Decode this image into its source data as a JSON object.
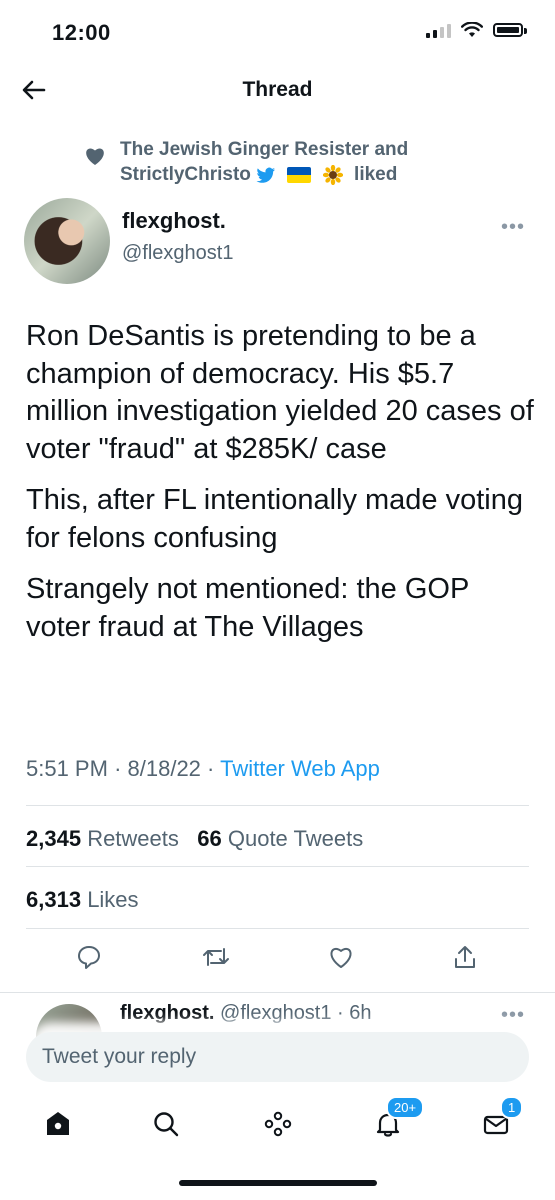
{
  "status": {
    "time": "12:00"
  },
  "header": {
    "title": "Thread",
    "back_icon": "arrow-left-icon"
  },
  "liked": {
    "line1": "The Jewish Ginger Resister and",
    "line2_name": "StrictlyChristo",
    "line2_suffix": "liked",
    "icons": [
      "heart-icon",
      "bird-icon",
      "ukraine-flag-icon",
      "sunflower-icon"
    ]
  },
  "tweet": {
    "author_name": "flexghost.",
    "author_handle": "@flexghost1",
    "paragraphs": [
      "Ron DeSantis is pretending to be a champion of democracy. His $5.7 million investigation yielded 20 cases of voter \"fraud\" at $285K/ case",
      "This, after FL intentionally made voting for felons confusing",
      "Strangely not mentioned: the GOP voter fraud at The Villages"
    ],
    "time": "5:51 PM",
    "date": "8/18/22",
    "source": "Twitter Web App",
    "retweets_count": "2,345",
    "retweets_label": "Retweets",
    "quotes_count": "66",
    "quotes_label": "Quote Tweets",
    "likes_count": "6,313",
    "likes_label": "Likes"
  },
  "next_tweet": {
    "name": "flexghost.",
    "meta": "@flexghost1 · 6h"
  },
  "reply": {
    "placeholder": "Tweet your reply"
  },
  "tabbar": {
    "notifications_badge": "20+",
    "messages_badge": "1"
  },
  "colors": {
    "accent": "#1d9bf0",
    "text": "#0f1419",
    "muted": "#536471"
  }
}
